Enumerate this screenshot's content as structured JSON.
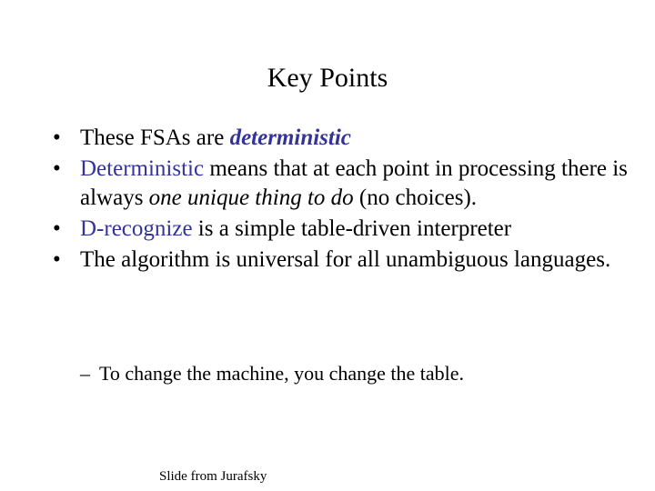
{
  "slide": {
    "title": "Key Points",
    "accent_color": "#333399",
    "bullets": [
      {
        "marker": "•",
        "parts": [
          {
            "text": "These FSAs are "
          },
          {
            "text": "deterministic"
          }
        ]
      },
      {
        "marker": "•",
        "parts": [
          {
            "text": "Deterministic"
          },
          {
            "text": " means that at each point in processing there is always "
          },
          {
            "text": "one unique thing to do"
          },
          {
            "text": " (no choices)."
          }
        ]
      },
      {
        "marker": "•",
        "parts": [
          {
            "text": "D-recognize"
          },
          {
            "text": " is a simple table-driven interpreter"
          }
        ]
      },
      {
        "marker": "•",
        "parts": [
          {
            "text": "The algorithm is universal for all unambiguous languages."
          }
        ]
      }
    ],
    "sub_bullet": {
      "marker": "–",
      "text": "To change the machine, you change the table."
    },
    "footer": "Slide from Jurafsky"
  }
}
